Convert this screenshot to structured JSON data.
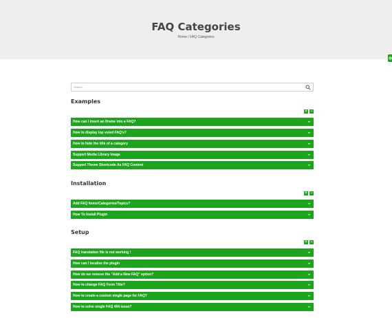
{
  "header": {
    "title": "FAQ Categories",
    "breadcrumb": "Home / FAQ Categories"
  },
  "side_tab": {
    "icon": "gear-icon"
  },
  "search": {
    "placeholder": "Search..."
  },
  "controls": {
    "expand_label": "+",
    "collapse_label": "−"
  },
  "colors": {
    "accent": "#1ca41c",
    "hero_bg": "#eeeeee",
    "title": "#444444"
  },
  "categories": [
    {
      "name": "Examples",
      "items": [
        "How can I insert an Iframe into a FAQ?",
        "How to display top voted FAQ's?",
        "How to hide the title of a category",
        "Support Media Library Image",
        "Support Theme Shortcode As FAQ Content"
      ]
    },
    {
      "name": "Installation",
      "items": [
        "Add FAQ Items/Categories/Topics?",
        "How To Install Plugin"
      ]
    },
    {
      "name": "Setup",
      "items": [
        "FAQ translation file is not working !",
        "How can I localize the plugin",
        "How do we remove the \"Add a New FAQ\" option?",
        "How to change FAQ Form Title?",
        "How to create a custom single page for FAQ?",
        "How to solve single FAQ 404 issue?"
      ]
    }
  ]
}
